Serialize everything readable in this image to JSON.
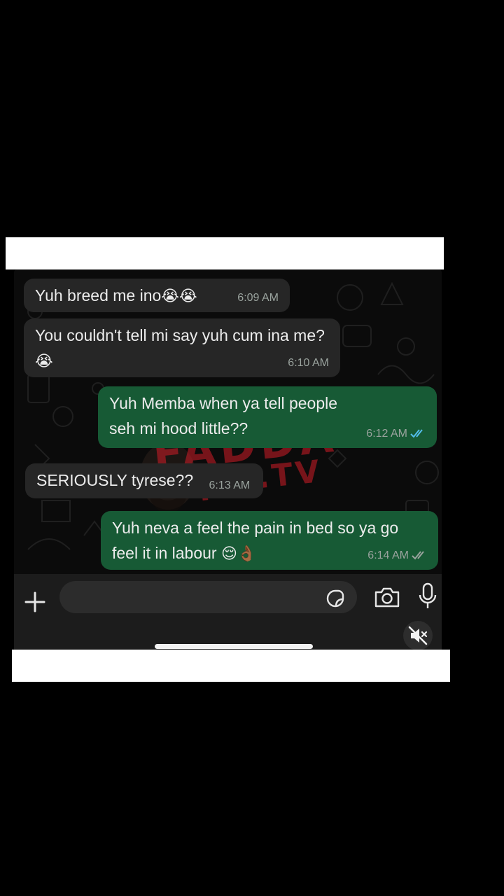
{
  "caption": {
    "emojis": "😂😂😂😂"
  },
  "chat": {
    "messages": [
      {
        "direction": "in",
        "text": "Yuh breed me ino",
        "emoji": "😭😭",
        "time": "6:09 AM"
      },
      {
        "direction": "in",
        "text": "You couldn't tell mi say yuh cum ina me?",
        "emoji": "😭",
        "time": "6:10 AM"
      },
      {
        "direction": "out",
        "text": "Yuh Memba when ya tell people seh mi hood little??",
        "emoji": "",
        "time": "6:12 AM",
        "status": "read"
      },
      {
        "direction": "in",
        "text": "SERIOUSLY tyrese??",
        "emoji": "",
        "time": "6:13 AM"
      },
      {
        "direction": "out",
        "text": "Yuh neva a feel the pain in bed so ya go feel it in labour",
        "emoji": "😌👌🏾",
        "time": "6:14 AM",
        "status": "delivered"
      }
    ]
  },
  "watermark": {
    "line1": "FADDA",
    "line2": "Epic.TV"
  },
  "composer": {
    "input_value": "",
    "input_placeholder": "",
    "icons": [
      "plus-icon",
      "sticker-icon",
      "camera-icon",
      "microphone-icon",
      "speaker-muted-icon"
    ]
  },
  "colors": {
    "background": "#000000",
    "incoming_bubble": "#262626",
    "outgoing_bubble": "#175a35",
    "read_ticks": "#53bdeb",
    "delivered_ticks": "#9aa39e",
    "watermark": "#d21e28"
  }
}
